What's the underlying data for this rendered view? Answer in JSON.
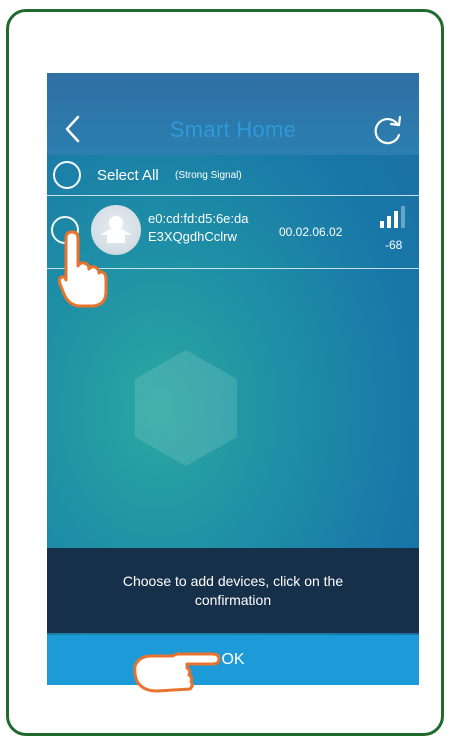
{
  "header": {
    "title": "Smart Home",
    "back_icon": "chevron-left-icon",
    "refresh_icon": "refresh-icon"
  },
  "select_all": {
    "label": "Select All",
    "sublabel": "(Strong Signal)"
  },
  "devices": [
    {
      "mac": "e0:cd:fd:d5:6e:da",
      "name": "E3XQgdhCclrw",
      "version": "00.02.06.02",
      "rssi": "-68",
      "signal_bars": 3,
      "signal_max_bars": 4
    }
  ],
  "hint": "Choose to add devices, click on the confirmation",
  "ok_label": "OK",
  "colors": {
    "frame": "#1f6a2e",
    "title": "#2f9ad9",
    "ok_bar": "#1c9bd8",
    "hint_bar": "#17304a",
    "pointer_hand": "#e8732e"
  }
}
